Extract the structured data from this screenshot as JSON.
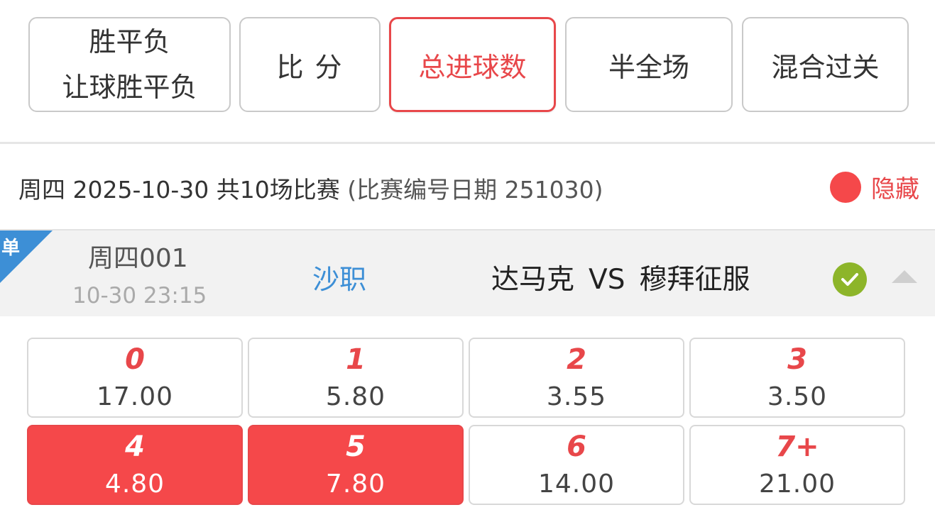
{
  "tabs": [
    {
      "label_line1": "胜平负",
      "label_line2": "让球胜平负"
    },
    {
      "label": "比 分"
    },
    {
      "label": "总进球数"
    },
    {
      "label": "半全场"
    },
    {
      "label": "混合过关"
    }
  ],
  "date_bar": {
    "title": "周四 2025-10-30 共10场比赛",
    "subtitle": "(比赛编号日期 251030)",
    "hide_label": "隐藏"
  },
  "match": {
    "badge": "单",
    "number": "周四001",
    "time": "10-30 23:15",
    "league": "沙职",
    "home": "达马克",
    "vs": "VS",
    "away": "穆拜征服",
    "status_icon": "check-circle-icon",
    "collapse_icon": "caret-up-icon"
  },
  "options": [
    {
      "goals": "0",
      "odds": "17.00",
      "selected": false
    },
    {
      "goals": "1",
      "odds": "5.80",
      "selected": false
    },
    {
      "goals": "2",
      "odds": "3.55",
      "selected": false
    },
    {
      "goals": "3",
      "odds": "3.50",
      "selected": false
    },
    {
      "goals": "4",
      "odds": "4.80",
      "selected": true
    },
    {
      "goals": "5",
      "odds": "7.80",
      "selected": true
    },
    {
      "goals": "6",
      "odds": "14.00",
      "selected": false
    },
    {
      "goals": "7+",
      "odds": "21.00",
      "selected": false
    }
  ],
  "colors": {
    "accent": "#e8474a",
    "league_blue": "#3d8fd6",
    "check_green": "#8db52a"
  }
}
